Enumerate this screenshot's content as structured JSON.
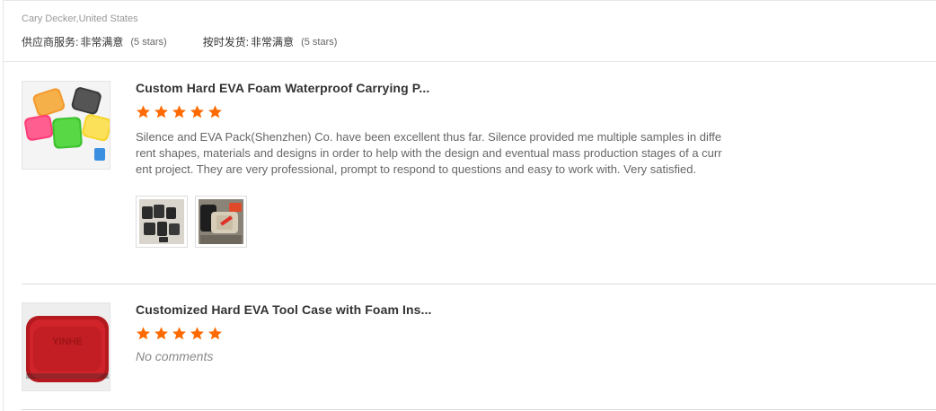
{
  "reviewer": {
    "name": "Cary Decker,United States",
    "ratings": [
      {
        "label": "供应商服务:",
        "value": "非常满意",
        "stars_text": "(5 stars)"
      },
      {
        "label": "按时发货:",
        "value": "非常满意",
        "stars_text": "(5 stars)"
      }
    ]
  },
  "reviews": [
    {
      "product_title": "Custom Hard EVA Foam Waterproof Carrying P...",
      "rating": 5,
      "text": "Silence and EVA Pack(Shenzhen) Co. have been excellent thus far. Silence provided me multiple samples in different shapes, materials and designs in order to help with the design and eventual mass production stages of a current project. They are very professional, prompt to respond to questions and easy to work with. Very satisfied.",
      "photo_count": 2
    },
    {
      "product_title": "Customized Hard EVA Tool Case with Foam Ins...",
      "rating": 5,
      "text": "No comments"
    }
  ],
  "colors": {
    "star": "#ff6a00",
    "divider": "#dcdcdc"
  },
  "icons": {
    "star": "star-icon"
  }
}
